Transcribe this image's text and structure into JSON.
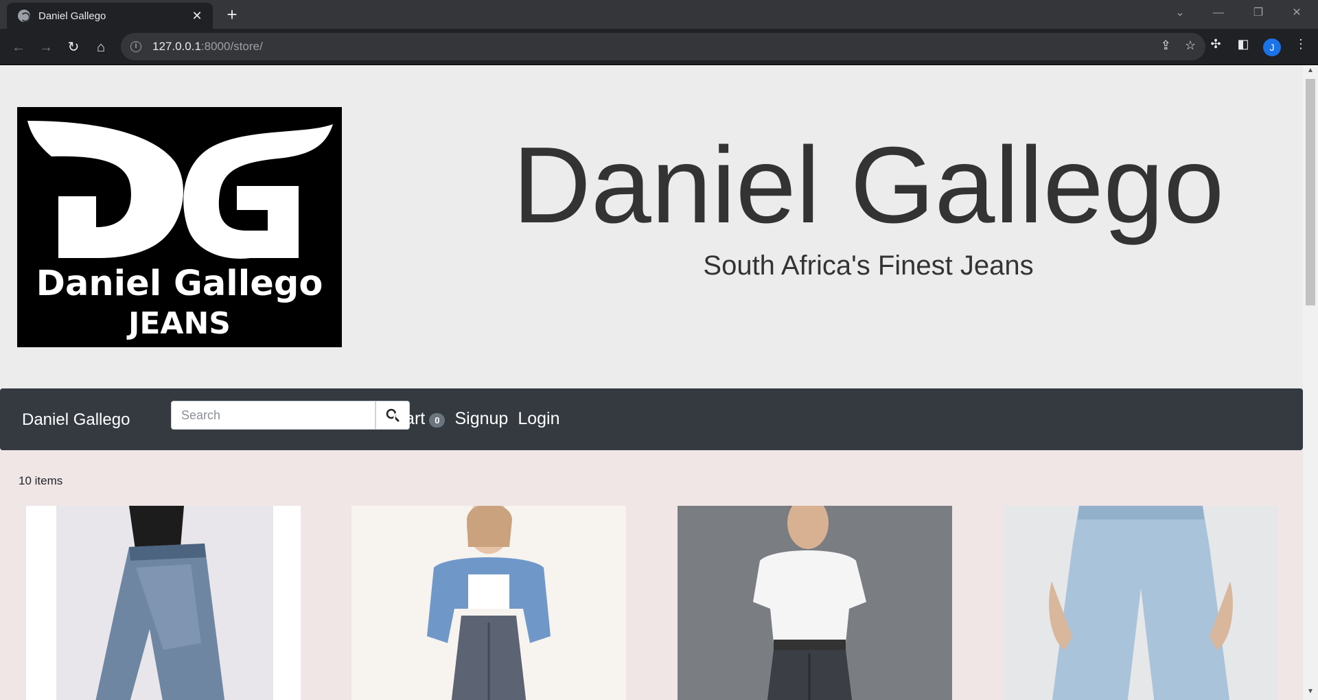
{
  "browser": {
    "tab_title": "Daniel Gallego",
    "url_host": "127.0.0.1",
    "url_path": ":8000/store/",
    "profile_initial": "J"
  },
  "hero": {
    "logo_line1": "Daniel Gallego",
    "logo_line2": "JEANS",
    "title": "Daniel Gallego",
    "subtitle": "South Africa's Finest Jeans"
  },
  "navbar": {
    "brand": "Daniel Gallego",
    "search_placeholder": "Search",
    "cart_label": "Cart",
    "cart_count": "0",
    "signup_label": "Signup",
    "login_label": "Login"
  },
  "store": {
    "item_count": "10 items"
  },
  "colors": {
    "navbar": "#343a40",
    "hero_bg": "#ececec",
    "page_bg": "#f0e6e6"
  }
}
